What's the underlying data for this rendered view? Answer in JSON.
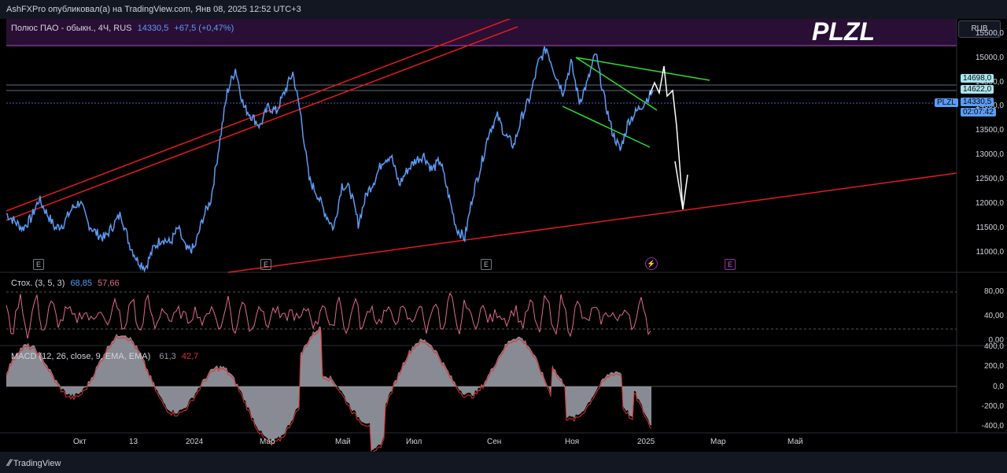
{
  "header": {
    "publisher_line": "AshFXPro опубликовал(а) на TradingView.com, Янв 08, 2025 12:52 UTC+3"
  },
  "symbol_line": {
    "name": "Полюс ПАО - обыкн., 4Ч, RUS",
    "price": "14330,5",
    "change": "+67,5 (+0,47%)"
  },
  "ticker_big": "PLZL",
  "currency": "RUB",
  "price_axis": [
    "15500,0",
    "15000,0",
    "14500,0",
    "14000,0",
    "13500,0",
    "13000,0",
    "12500,0",
    "12000,0",
    "11500,0",
    "11000,0"
  ],
  "price_tags": {
    "t1": "14698,0",
    "t2": "14622,0",
    "last": "14330,5",
    "countdown": "02:07:42",
    "symbol_tag": "PLZL"
  },
  "stoch": {
    "label": "Стох. (3, 5, 3)",
    "k": "68,85",
    "d": "57,66",
    "axis": [
      "80,00",
      "40,00",
      "0,00"
    ]
  },
  "macd": {
    "label": "MACD (12, 26, close, 9, EMA, EMA)",
    "v1": "61,3",
    "v2": "42,7",
    "axis": [
      "400,0",
      "200,0",
      "0,0",
      "-200,0",
      "-400,0"
    ]
  },
  "time_axis": [
    "Окт",
    "13",
    "2024",
    "Мар",
    "Май",
    "Июл",
    "Сен",
    "Ноя",
    "2025",
    "Мар",
    "Май"
  ],
  "earnings_marker": "E",
  "footer_brand": "TradingView",
  "colors": {
    "price_line": "#5b9cf6",
    "trend_red": "#e21b1b",
    "channel_green": "#2ee02e",
    "stoch_k": "#e06b8d",
    "macd_red": "#e03030",
    "highlight_band": "#2a0f35"
  },
  "chart_data": {
    "type": "line",
    "title": "Полюс ПАО - обыкн., 4Ч, RUS",
    "ylim": [
      10600,
      15800
    ],
    "x": [
      "Окт",
      "13",
      "2024",
      "Мар",
      "Май",
      "Июл",
      "Сен",
      "Ноя",
      "2025",
      "Мар",
      "Май"
    ],
    "series": [
      {
        "values": [
          11800,
          11650,
          11500,
          11700,
          12100,
          11800,
          11500,
          11600,
          11900,
          12050,
          11600,
          11400,
          11300,
          11550,
          11800,
          11200,
          10850,
          10700,
          11100,
          11300,
          11200,
          11500,
          11050,
          11100,
          11700,
          12100,
          13200,
          14300,
          14780,
          14000,
          13800,
          13600,
          14000,
          13900,
          14300,
          14700,
          13800,
          12500,
          12200,
          11800,
          11500,
          12400,
          12300,
          11600,
          12200,
          12500,
          12900,
          13000,
          12400,
          12700,
          12900,
          13000,
          12700,
          12900,
          12200,
          11500,
          11300,
          12200,
          12800,
          13500,
          13800,
          13400,
          13200,
          13800,
          14200,
          14900,
          15200,
          14700,
          14300,
          14900,
          14100,
          14500,
          15100,
          14200,
          13500,
          13100,
          13700,
          13900,
          14100,
          14330
        ]
      }
    ]
  }
}
